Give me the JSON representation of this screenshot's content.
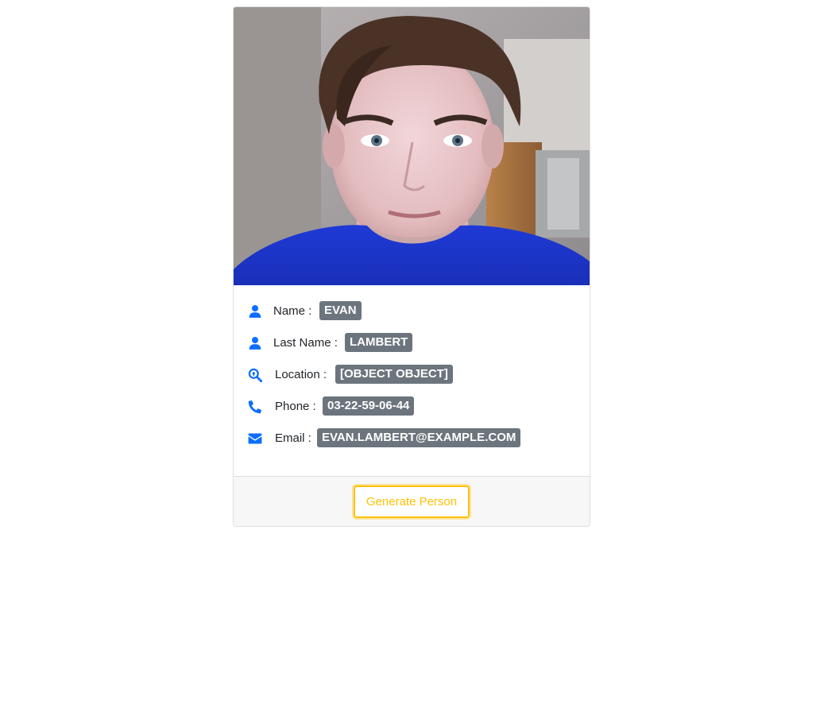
{
  "person": {
    "photo_alt": "Profile photo",
    "fields": [
      {
        "icon": "user-icon",
        "label": "Name :",
        "value": "EVAN"
      },
      {
        "icon": "user-icon",
        "label": "Last Name :",
        "value": "LAMBERT"
      },
      {
        "icon": "map-search-icon",
        "label": "Location :",
        "value": "[OBJECT OBJECT]"
      },
      {
        "icon": "phone-icon",
        "label": "Phone :",
        "value": "03-22-59-06-44"
      },
      {
        "icon": "envelope-icon",
        "label": "Email :",
        "value": "EVAN.LAMBERT@EXAMPLE.COM"
      }
    ]
  },
  "footer": {
    "generate_label": "Generate Person"
  },
  "colors": {
    "icon_accent": "#0d6efd",
    "badge_bg": "#6c757d",
    "button_warning": "#ffc107"
  }
}
